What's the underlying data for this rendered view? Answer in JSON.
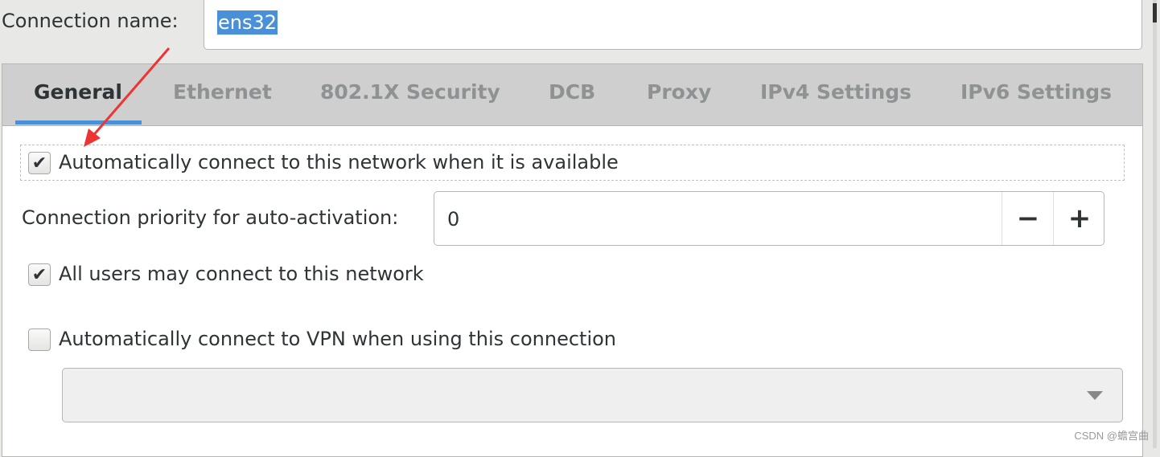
{
  "connection": {
    "label": "Connection name:",
    "value": "ens32"
  },
  "tabs": [
    {
      "label": "General",
      "active": true
    },
    {
      "label": "Ethernet",
      "active": false
    },
    {
      "label": "802.1X Security",
      "active": false
    },
    {
      "label": "DCB",
      "active": false
    },
    {
      "label": "Proxy",
      "active": false
    },
    {
      "label": "IPv4 Settings",
      "active": false
    },
    {
      "label": "IPv6 Settings",
      "active": false
    }
  ],
  "general": {
    "auto_connect": {
      "label": "Automatically connect to this network when it is available",
      "checked": true
    },
    "priority": {
      "label": "Connection priority for auto-activation:",
      "value": "0",
      "minus": "−",
      "plus": "+"
    },
    "all_users": {
      "label": "All users may connect to this network",
      "checked": true
    },
    "auto_vpn": {
      "label": "Automatically connect to VPN when using this connection",
      "checked": false
    },
    "vpn_select": {
      "value": ""
    }
  },
  "annotation": {
    "arrow_color": "#ee3333"
  },
  "colors": {
    "accent": "#4a90d9"
  },
  "watermark": "CSDN @蟾宫曲"
}
